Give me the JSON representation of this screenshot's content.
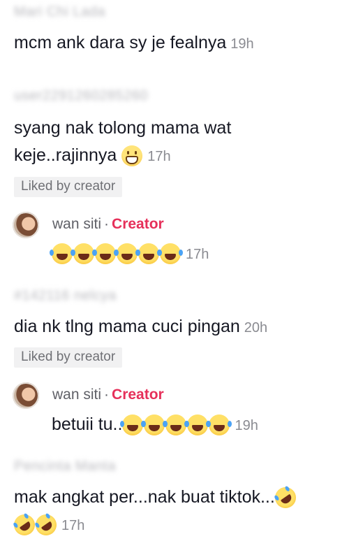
{
  "comments": [
    {
      "username": "Mari Chi Lada",
      "text": "mcm ank dara sy je fealnya",
      "time": "19h"
    },
    {
      "username": "user2291260285260",
      "text_line1": "syang nak tolong mama wat",
      "text_line2": "keje..rajinnya",
      "emoji": "grinning-face-icon",
      "time": "17h",
      "liked_label": "Liked by creator",
      "reply": {
        "username": "wan siti",
        "separator": "·",
        "badge": "Creator",
        "emojis": [
          "joy",
          "joy",
          "joy",
          "joy",
          "joy",
          "joy"
        ],
        "time": "17h"
      }
    },
    {
      "username": "#142116 nelcya",
      "text": "dia nk tlng mama cuci pingan",
      "time": "20h",
      "liked_label": "Liked by creator",
      "reply": {
        "username": "wan siti",
        "separator": "·",
        "badge": "Creator",
        "text": "betuii tu..",
        "emojis": [
          "joy",
          "joy",
          "joy",
          "joy",
          "joy"
        ],
        "time": "19h"
      }
    },
    {
      "username": "Pencinta Manta",
      "text_line1": "mak angkat per...nak buat tiktok...",
      "emojis": [
        "rofl",
        "rofl",
        "rofl"
      ],
      "time": "17h"
    }
  ],
  "colors": {
    "creator_accent": "#e6305a",
    "muted_text": "#8a8b91",
    "liked_bg": "#f1f1f2"
  }
}
